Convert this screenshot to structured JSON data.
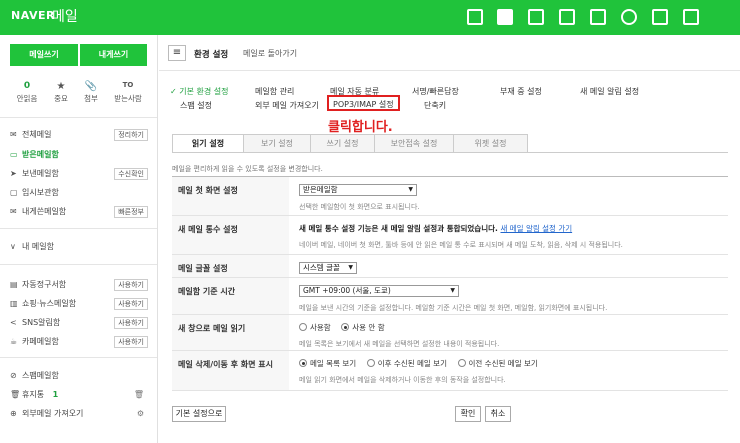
{
  "header": {
    "logo": "NAVER",
    "service": "메일",
    "icons": [
      "sms-icon",
      "mail-icon",
      "calendar-icon",
      "list-icon",
      "contacts-icon",
      "cloud-icon",
      "grid-icon",
      "word-icon"
    ]
  },
  "sidebar": {
    "write_button": "메일쓰기",
    "self_button": "내게쓰기",
    "quick": [
      {
        "top": "0",
        "label": "안읽음"
      },
      {
        "top": "★",
        "label": "중요"
      },
      {
        "top": "📎",
        "label": "첨부"
      },
      {
        "top": "TO",
        "label": "받는사람"
      }
    ],
    "folders": [
      {
        "icon": "inbox-all-icon",
        "glyph": "✉",
        "label": "전체메일",
        "btn": "정리하기"
      },
      {
        "icon": "inbox-icon",
        "glyph": "▭",
        "label": "받은메일함",
        "btn": ""
      },
      {
        "icon": "send-icon",
        "glyph": "➤",
        "label": "보낸메일함",
        "btn": "수신확인"
      },
      {
        "icon": "draft-icon",
        "glyph": "▢",
        "label": "임시보관함",
        "btn": ""
      },
      {
        "icon": "self-mail-icon",
        "glyph": "✉",
        "label": "내게쓴메일함",
        "btn": "빠른정부"
      }
    ],
    "my_folder": "내 메일함",
    "smart_folders": [
      {
        "icon": "auto-folder-icon",
        "glyph": "▤",
        "label": "자동정구서함",
        "btn": "사용하기"
      },
      {
        "icon": "shopping-icon",
        "glyph": "▥",
        "label": "쇼핑·뉴스메일함",
        "btn": "사용하기"
      },
      {
        "icon": "sns-icon",
        "glyph": "<",
        "label": "SNS알림함",
        "btn": "사용하기"
      },
      {
        "icon": "cafe-icon",
        "glyph": "☕",
        "label": "카페메일함",
        "btn": "사용하기"
      }
    ],
    "bottom": [
      {
        "icon": "spam-icon",
        "glyph": "⊘",
        "label": "스팸메일함",
        "extra": ""
      },
      {
        "icon": "trash-icon",
        "glyph": "🗑",
        "label": "휴지통",
        "count": "1",
        "extra": "🗑"
      },
      {
        "icon": "external-mail-icon",
        "glyph": "⊕",
        "label": "외부메일 가져오기",
        "extra": "⚙"
      }
    ]
  },
  "content": {
    "title": "환경 설정",
    "back_link": "메일로 돌아가기",
    "menu": {
      "basic": "✓ 기본 환경 설정",
      "folder": "메일함 관리",
      "auto": "메일 자동 분류",
      "sign": "서명/빠른답장",
      "absence": "부재 중 설정",
      "alarm": "새 메일 알림 설정",
      "spam": "스팸 설정",
      "external": "외부 메일 가져오기",
      "pop": "POP3/IMAP 설정",
      "shortcut": "단축키"
    },
    "annotation": "클릭합니다.",
    "tabs": [
      "읽기 설정",
      "보기 설정",
      "쓰기 설정",
      "보안접속 설정",
      "위젯 설정"
    ],
    "intro": "메일을 편리하게 읽을 수 있도록 설정을 변경합니다.",
    "rows": {
      "first_screen": {
        "label": "메일 첫 화면 설정",
        "select": "받은메일함",
        "desc": "선택한 메일함이 첫 화면으로 표시됩니다."
      },
      "new_count": {
        "label": "새 메일 통수 설정",
        "text": "새 메일 통수 설정 기능은 새 메일 알림 설정과 통합되었습니다.",
        "link": "새 메일 알림 설정 가기",
        "desc": "네이버 메일, 네이버 첫 화면, 툴바 등에 안 읽은 메일 통 수로 표시되며 새 메일 도착, 읽음, 삭제 시 적용됩니다."
      },
      "font": {
        "label": "메일 글꼴 설정",
        "select": "시스템 글꼴"
      },
      "timezone": {
        "label": "메일함 기준 시간",
        "select": "GMT +09:00 (서울, 도쿄)",
        "desc": "메일을 보낸 시간의 기준을 설정합니다. 메일함 기준 시간은 메일 첫 화면, 메일함, 읽기화면에 표시됩니다."
      },
      "new_window": {
        "label": "새 창으로 메일 읽기",
        "options": [
          "사용함",
          "사용 안 함"
        ],
        "selected": 1,
        "desc": "메일 목록은 보기에서 새 메일을 선택하면 설정한 내용이 적용됩니다."
      },
      "after_delete": {
        "label": "메일 삭제/이동 후 화면 표시",
        "options": [
          "메일 목록 보기",
          "이후 수신된 메일 보기",
          "이전 수신된 메일 보기"
        ],
        "selected": 0,
        "desc": "메일 읽기 화면에서 메일을 삭제하거나 이동한 후의 동작을 설정합니다."
      }
    },
    "reset_button": "기본 설정으로",
    "ok_button": "확인",
    "cancel_button": "취소"
  }
}
